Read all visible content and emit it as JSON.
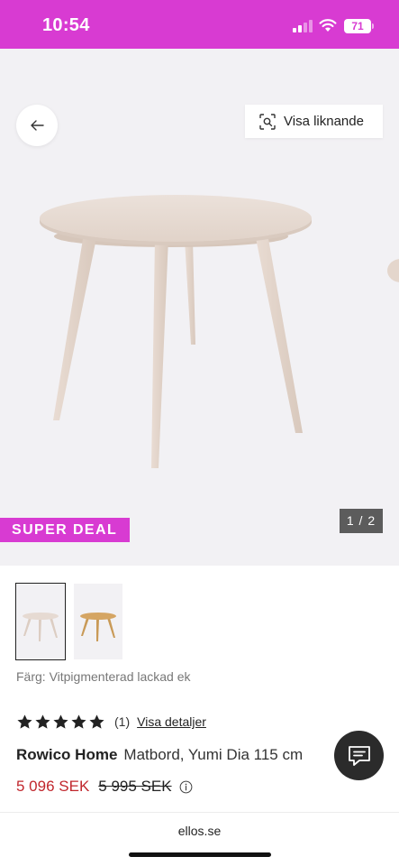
{
  "status_bar": {
    "time": "10:54",
    "battery": "71",
    "background": "#d83bd2"
  },
  "gallery": {
    "similar_button_label": "Visa liknande",
    "badge": "SUPER DEAL",
    "counter": "1 / 2",
    "icons": [
      "arrow-left-icon",
      "visual-search-icon"
    ]
  },
  "product": {
    "color_label": "Färg: Vitpigmenterad lackad ek",
    "rating": 5,
    "review_count": "(1)",
    "details_link": "Visa detaljer",
    "brand": "Rowico Home",
    "name": "Matbord, Yumi Dia 115 cm",
    "price_now": "5 096 SEK",
    "price_old": "5 995 SEK",
    "price_color": "#c1272d"
  },
  "browser": {
    "url": "ellos.se"
  }
}
